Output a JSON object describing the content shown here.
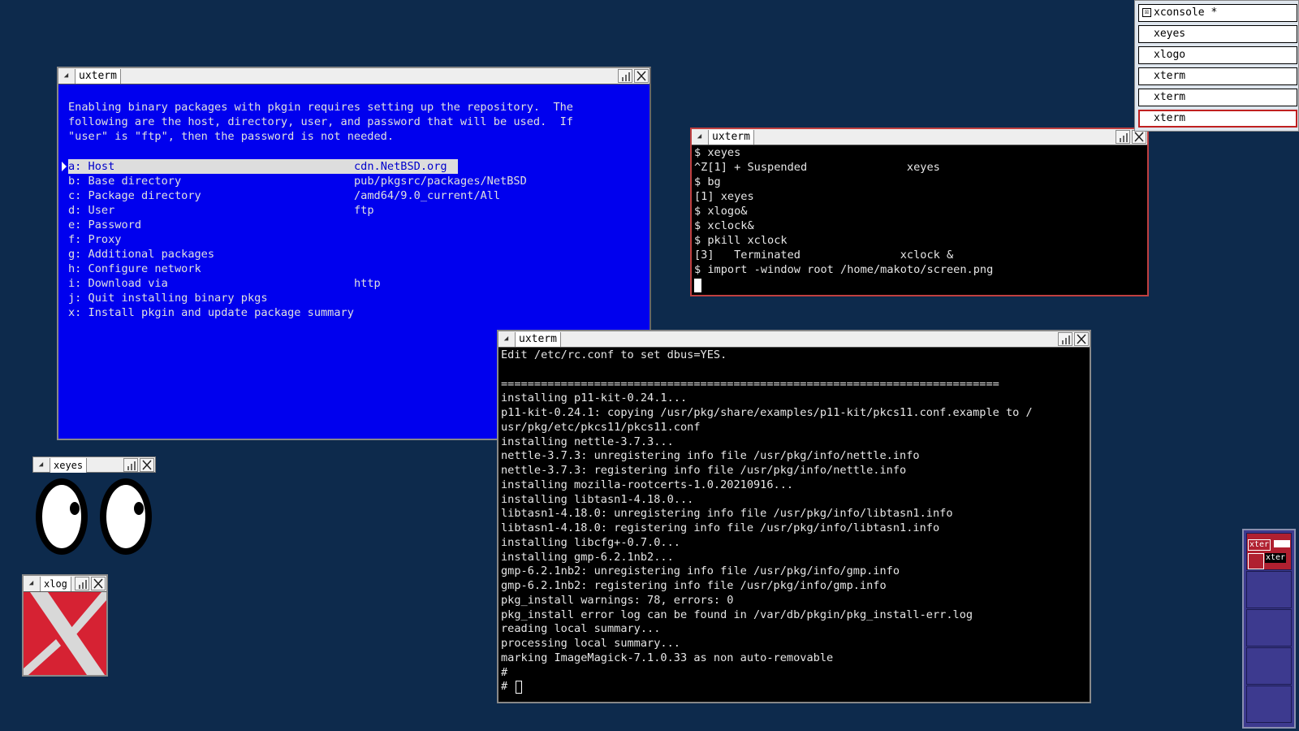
{
  "colors": {
    "desktop": "#0d2a4c",
    "pkgin_bg": "#0000ee",
    "terminal_bg": "#000000",
    "active_border": "#c04040",
    "xlogo_red": "#d62233"
  },
  "pkgin_window": {
    "title": "uxterm",
    "intro": [
      "Enabling binary packages with pkgin requires setting up the repository.  The",
      "following are the host, directory, user, and password that will be used.  If",
      "\"user\" is \"ftp\", then the password is not needed."
    ],
    "menu": [
      {
        "label": "a: Host",
        "value": "cdn.NetBSD.org",
        "selected": true
      },
      {
        "label": "b: Base directory",
        "value": "pub/pkgsrc/packages/NetBSD"
      },
      {
        "label": "c: Package directory",
        "value": "/amd64/9.0_current/All"
      },
      {
        "label": "d: User",
        "value": "ftp"
      },
      {
        "label": "e: Password",
        "value": ""
      },
      {
        "label": "f: Proxy",
        "value": ""
      },
      {
        "label": "g: Additional packages",
        "value": ""
      },
      {
        "label": "h: Configure network",
        "value": ""
      },
      {
        "label": "i: Download via",
        "value": "http"
      },
      {
        "label": "j: Quit installing binary pkgs",
        "value": ""
      },
      {
        "label": "x: Install pkgin and update package summary",
        "value": ""
      }
    ]
  },
  "shell_window": {
    "title": "uxterm",
    "lines": [
      "$ xeyes",
      "^Z[1] + Suspended               xeyes",
      "$ bg",
      "[1] xeyes",
      "$ xlogo&",
      "$ xclock&",
      "$ pkill xclock",
      "[3]   Terminated               xclock &",
      "$ import -window root /home/makoto/screen.png"
    ]
  },
  "install_window": {
    "title": "uxterm",
    "lines": [
      "Edit /etc/rc.conf to set dbus=YES.",
      "",
      "===========================================================================",
      "installing p11-kit-0.24.1...",
      "p11-kit-0.24.1: copying /usr/pkg/share/examples/p11-kit/pkcs11.conf.example to /",
      "usr/pkg/etc/pkcs11/pkcs11.conf",
      "installing nettle-3.7.3...",
      "nettle-3.7.3: unregistering info file /usr/pkg/info/nettle.info",
      "nettle-3.7.3: registering info file /usr/pkg/info/nettle.info",
      "installing mozilla-rootcerts-1.0.20210916...",
      "installing libtasn1-4.18.0...",
      "libtasn1-4.18.0: unregistering info file /usr/pkg/info/libtasn1.info",
      "libtasn1-4.18.0: registering info file /usr/pkg/info/libtasn1.info",
      "installing libcfg+-0.7.0...",
      "installing gmp-6.2.1nb2...",
      "gmp-6.2.1nb2: unregistering info file /usr/pkg/info/gmp.info",
      "gmp-6.2.1nb2: registering info file /usr/pkg/info/gmp.info",
      "pkg_install warnings: 78, errors: 0",
      "pkg_install error log can be found in /var/db/pkgin/pkg_install-err.log",
      "reading local summary...",
      "processing local summary...",
      "marking ImageMagick-7.1.0.33 as non auto-removable",
      "#",
      "# "
    ]
  },
  "xeyes_window": {
    "title": "xeyes"
  },
  "xlogo_window": {
    "title": "xlog"
  },
  "window_menu": {
    "items": [
      {
        "label": "xconsole *",
        "icon": "iconified-icon"
      },
      {
        "label": "xeyes"
      },
      {
        "label": "xlogo"
      },
      {
        "label": "xterm"
      },
      {
        "label": "xterm"
      },
      {
        "label": "xterm",
        "active": true
      }
    ]
  },
  "pager": {
    "mini_labels": [
      "xter",
      "xter"
    ]
  }
}
